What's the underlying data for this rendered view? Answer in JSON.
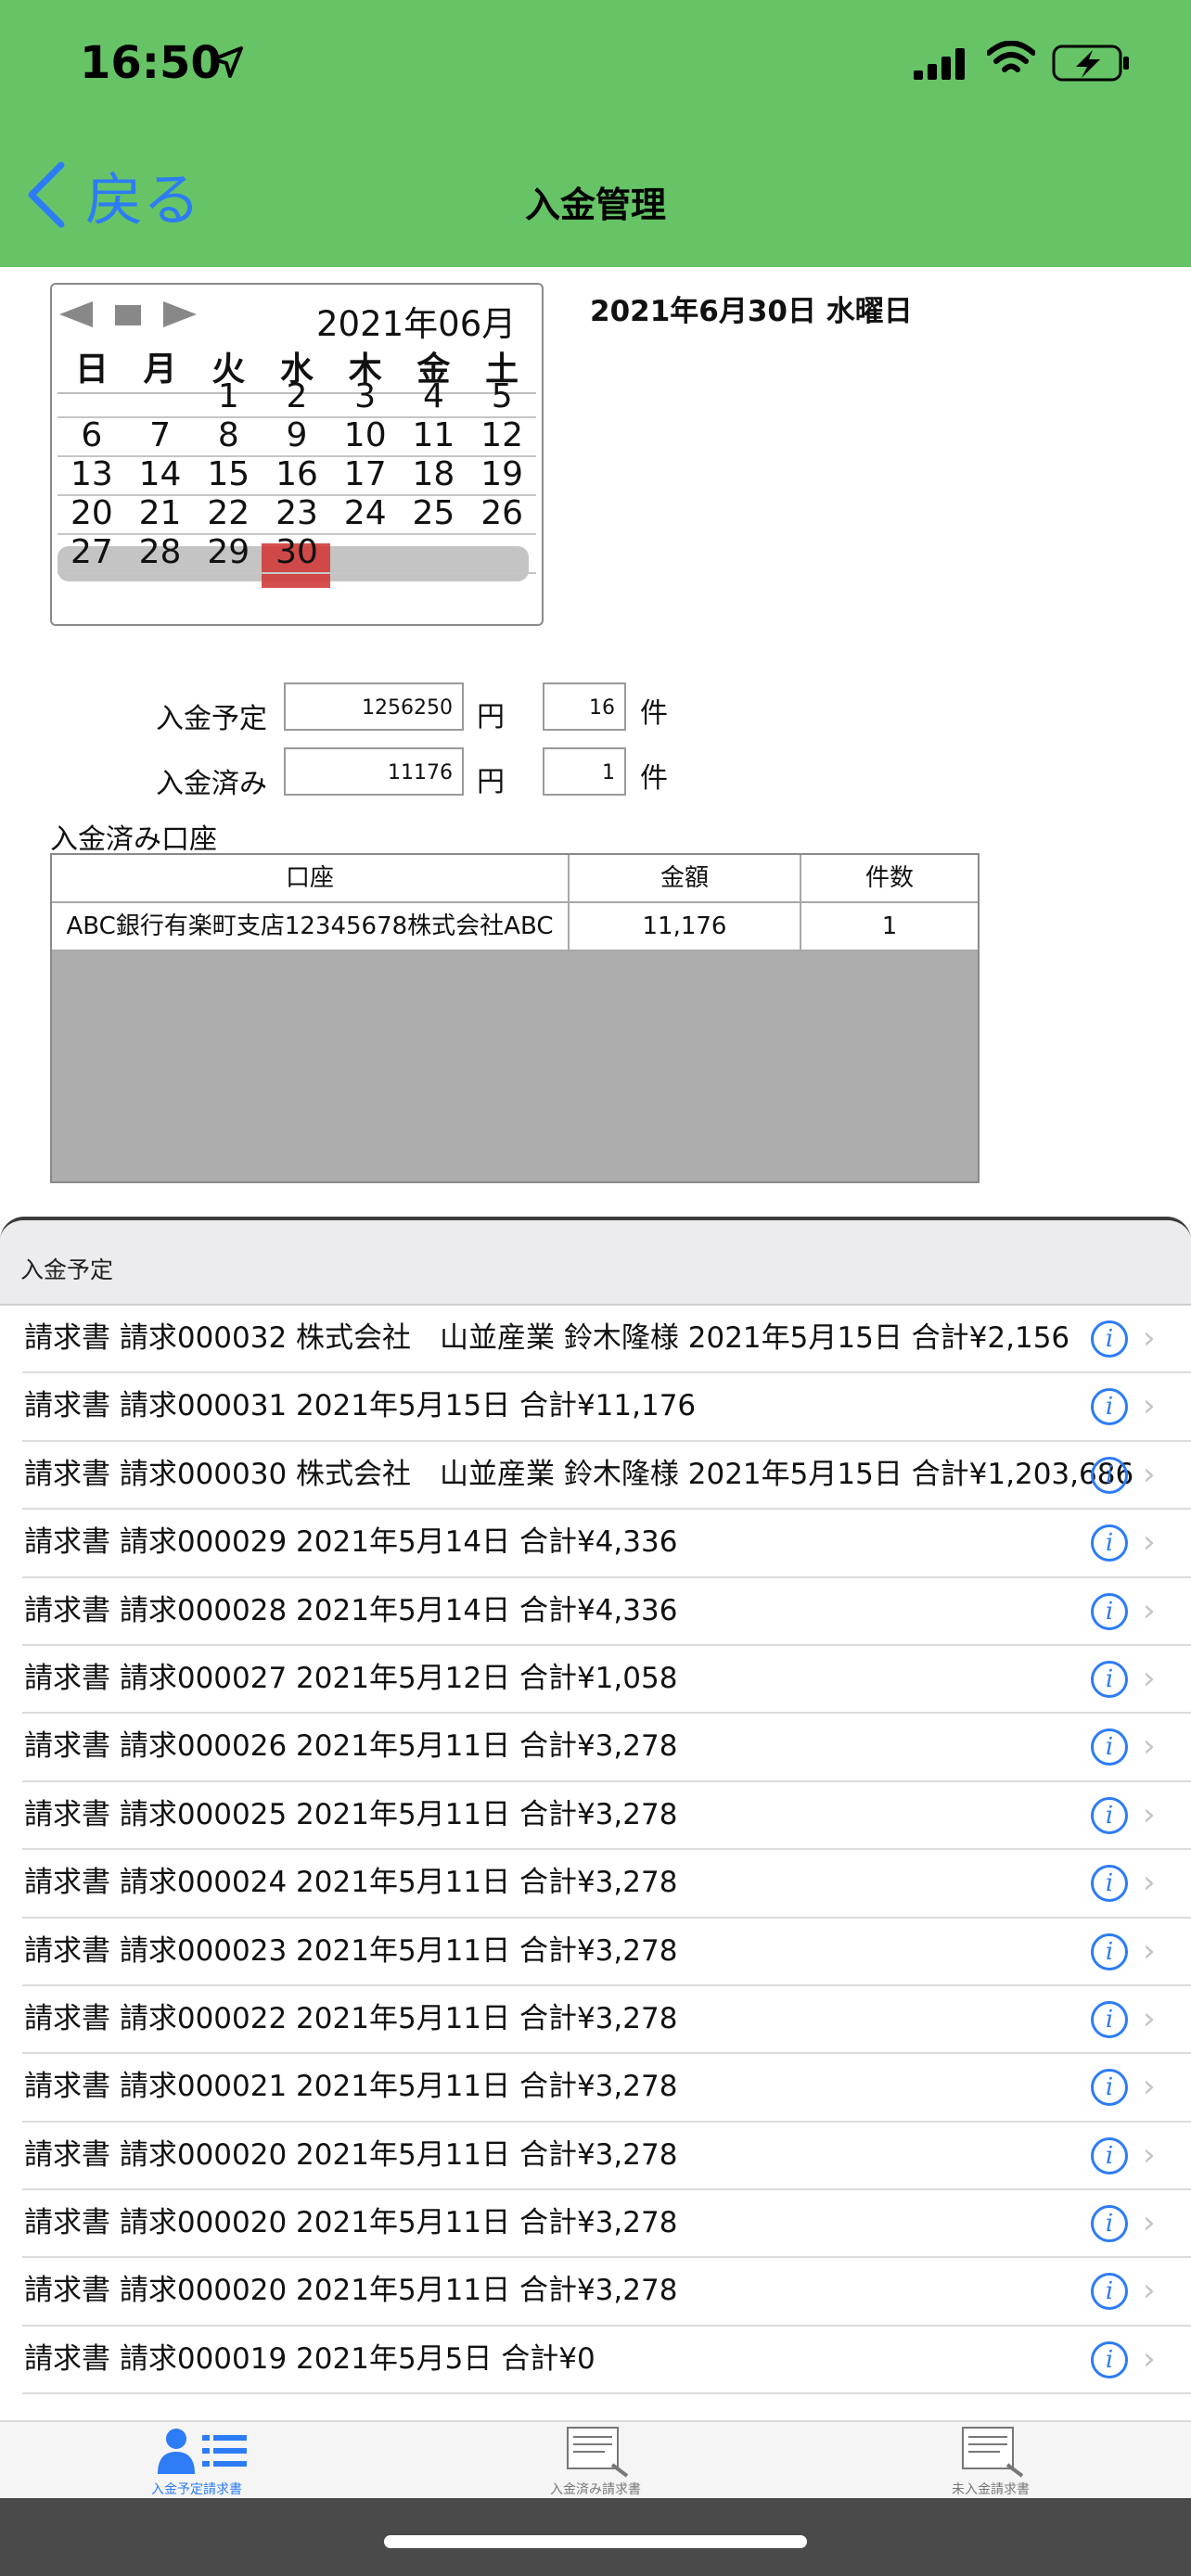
{
  "status": {
    "time": "16:50"
  },
  "nav": {
    "back_label": "戻る",
    "title": "入金管理"
  },
  "calendar": {
    "month": "2021年06月",
    "weekdays": [
      "日",
      "月",
      "火",
      "水",
      "木",
      "金",
      "土"
    ],
    "weeks": [
      [
        "",
        "",
        "1",
        "2",
        "3",
        "4",
        "5"
      ],
      [
        "6",
        "7",
        "8",
        "9",
        "10",
        "11",
        "12"
      ],
      [
        "13",
        "14",
        "15",
        "16",
        "17",
        "18",
        "19"
      ],
      [
        "20",
        "21",
        "22",
        "23",
        "24",
        "25",
        "26"
      ],
      [
        "27",
        "28",
        "29",
        "30",
        "",
        "",
        ""
      ]
    ],
    "selected": "30"
  },
  "selected_date": "2021年6月30日 水曜日",
  "summary": {
    "scheduled_label": "入金予定",
    "scheduled_amount": "1256250",
    "scheduled_count": "16",
    "paid_label": "入金済み",
    "paid_amount": "11176",
    "paid_count": "1",
    "yen_unit": "円",
    "count_unit": "件"
  },
  "accounts": {
    "title": "入金済み口座",
    "headers": [
      "口座",
      "金額",
      "件数"
    ],
    "rows": [
      [
        "ABC銀行有楽町支店12345678株式会社ABC",
        "11,176",
        "1"
      ]
    ]
  },
  "list": {
    "section_title": "入金予定",
    "items": [
      "請求書 請求000032 株式会社　山並産業 鈴木隆様 2021年5月15日 合計¥2,156",
      "請求書 請求000031   2021年5月15日 合計¥11,176",
      "請求書 請求000030 株式会社　山並産業 鈴木隆様 2021年5月15日 合計¥1,203,686",
      "請求書 請求000029   2021年5月14日 合計¥4,336",
      "請求書 請求000028   2021年5月14日 合計¥4,336",
      "請求書 請求000027   2021年5月12日 合計¥1,058",
      "請求書 請求000026   2021年5月11日 合計¥3,278",
      "請求書 請求000025   2021年5月11日 合計¥3,278",
      "請求書 請求000024   2021年5月11日 合計¥3,278",
      "請求書 請求000023   2021年5月11日 合計¥3,278",
      "請求書 請求000022   2021年5月11日 合計¥3,278",
      "請求書 請求000021   2021年5月11日 合計¥3,278",
      "請求書 請求000020   2021年5月11日 合計¥3,278",
      "請求書 請求000020   2021年5月11日 合計¥3,278",
      "請求書 請求000020   2021年5月11日 合計¥3,278",
      "請求書 請求000019   2021年5月5日 合計¥0"
    ],
    "info_glyph": "i",
    "chevron_glyph": "›"
  },
  "tabbar": {
    "tabs": [
      {
        "label": "入金予定請求書",
        "icon": "person-list-icon",
        "active": true
      },
      {
        "label": "入金済み請求書",
        "icon": "document-search-icon",
        "active": false
      },
      {
        "label": "未入金請求書",
        "icon": "document-search-icon",
        "active": false
      }
    ]
  },
  "colors": {
    "header_bg": "#66c466",
    "accent": "#2d7cf6",
    "selected_day": "#d23c3c"
  }
}
